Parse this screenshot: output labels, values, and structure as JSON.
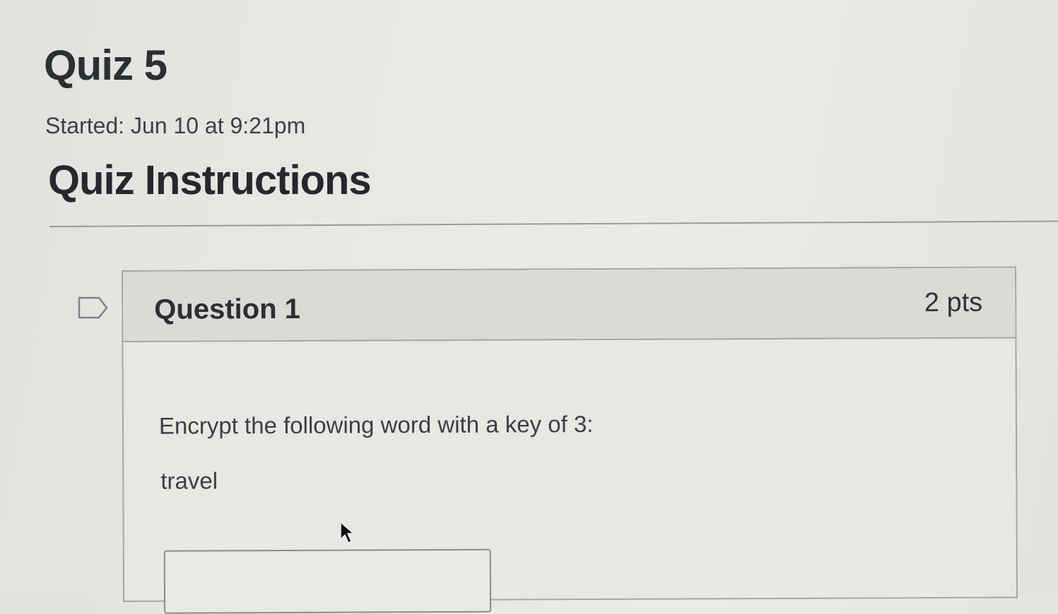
{
  "quiz": {
    "title": "Quiz 5",
    "started": "Started: Jun 10 at 9:21pm",
    "instructions_heading": "Quiz Instructions"
  },
  "question": {
    "label": "Question 1",
    "points": "2 pts",
    "prompt": "Encrypt the following word with a key of 3:",
    "word": "travel",
    "answer_value": ""
  },
  "icons": {
    "flag": "flag-outline-icon",
    "cursor": "mouse-pointer-icon"
  }
}
